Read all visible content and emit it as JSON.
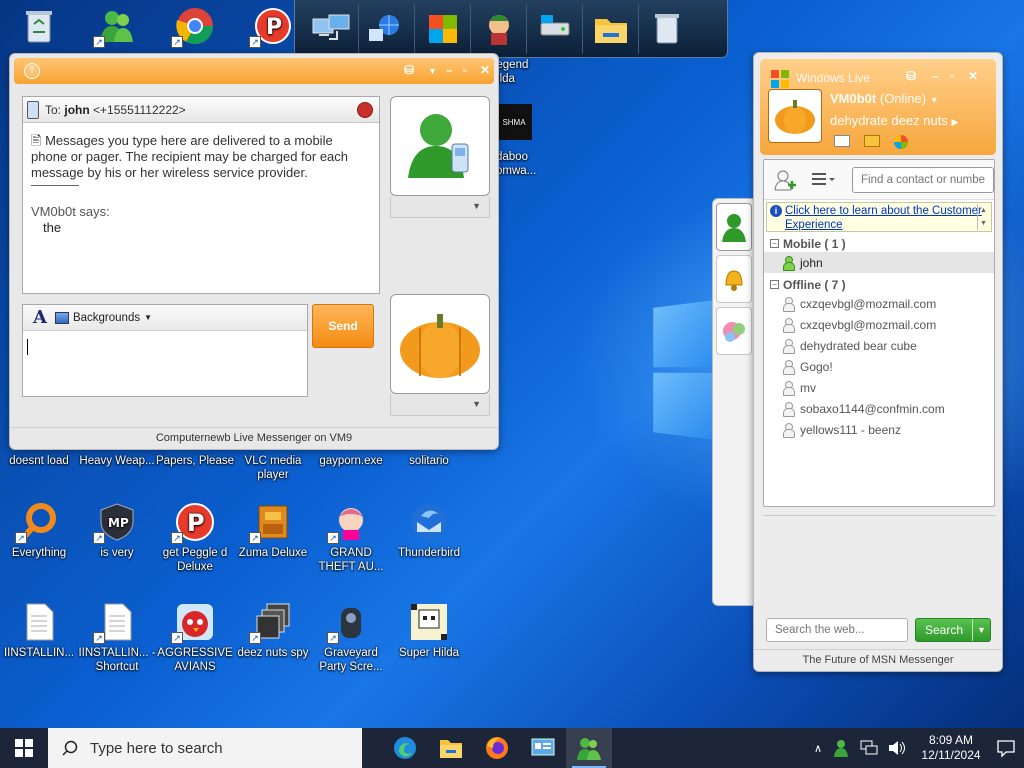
{
  "desktop": {
    "icons": [
      {
        "label": "doesnt load",
        "icon": "app-icon"
      },
      {
        "label": "Heavy Weap...",
        "icon": "app-icon"
      },
      {
        "label": "Papers, Please",
        "icon": "app-icon"
      },
      {
        "label": "VLC media player",
        "icon": "vlc-icon"
      },
      {
        "label": "gayporn.exe",
        "icon": "app-icon"
      },
      {
        "label": "solitario",
        "icon": "app-icon"
      },
      {
        "label": "Everything",
        "icon": "search-icon"
      },
      {
        "label": "is very",
        "icon": "app-icon"
      },
      {
        "label": "get Peggle d Deluxe",
        "icon": "peggle-icon"
      },
      {
        "label": "Zuma Deluxe",
        "icon": "zuma-icon"
      },
      {
        "label": "GRAND THEFT AU...",
        "icon": "game-icon"
      },
      {
        "label": "Thunderbird",
        "icon": "thunderbird-icon"
      },
      {
        "label": "IINSTALLIN...",
        "icon": "document-icon"
      },
      {
        "label": "IINSTALLIN... - Shortcut",
        "icon": "document-icon"
      },
      {
        "label": "AGGRESSIVE AVIANS",
        "icon": "angry-bird-icon"
      },
      {
        "label": "deez nuts spy",
        "icon": "app-icon"
      },
      {
        "label": "Graveyard Party Scre...",
        "icon": "game-icon"
      },
      {
        "label": "Super Hilda",
        "icon": "game-icon"
      },
      {
        "label": "Legend Zilda",
        "icon": "game-icon"
      },
      {
        "label": "daboo omwa...",
        "icon": "app-icon"
      }
    ]
  },
  "chat": {
    "to_prefix": "To:",
    "to_name": "john",
    "to_number": "<+15551112222>",
    "notice": "Messages you type here are delivered to a mobile phone or pager. The recipient may be charged for each message by his or her wireless service provider.",
    "sender_says": "VM0b0t says:",
    "message": "the",
    "backgrounds_label": "Backgrounds",
    "send_label": "Send",
    "status_bar": "Computernewb Live Messenger on VM9"
  },
  "contacts": {
    "title": "Windows Live",
    "display_name": "VM0b0t",
    "status": "(Online)",
    "personal_message": "dehydrate deez nuts",
    "find_placeholder": "Find a contact or number...",
    "info_link": "Click here to learn about the Customer Experience",
    "groups": [
      {
        "name": "Mobile ( 1 )",
        "contacts": [
          "john"
        ]
      },
      {
        "name": "Offline ( 7 )",
        "contacts": [
          "cxzqevbgl@mozmail.com",
          "cxzqevbgl@mozmail.com",
          "dehydrated bear cube",
          "Gogo!",
          "mv",
          "sobaxo1144@confmin.com",
          "yellows111 - beenz"
        ]
      }
    ],
    "web_search_placeholder": "Search the web...",
    "search_label": "Search",
    "footer": "The Future of MSN Messenger"
  },
  "taskbar": {
    "search_placeholder": "Type here to search",
    "time": "8:09 AM",
    "date": "12/11/2024"
  }
}
